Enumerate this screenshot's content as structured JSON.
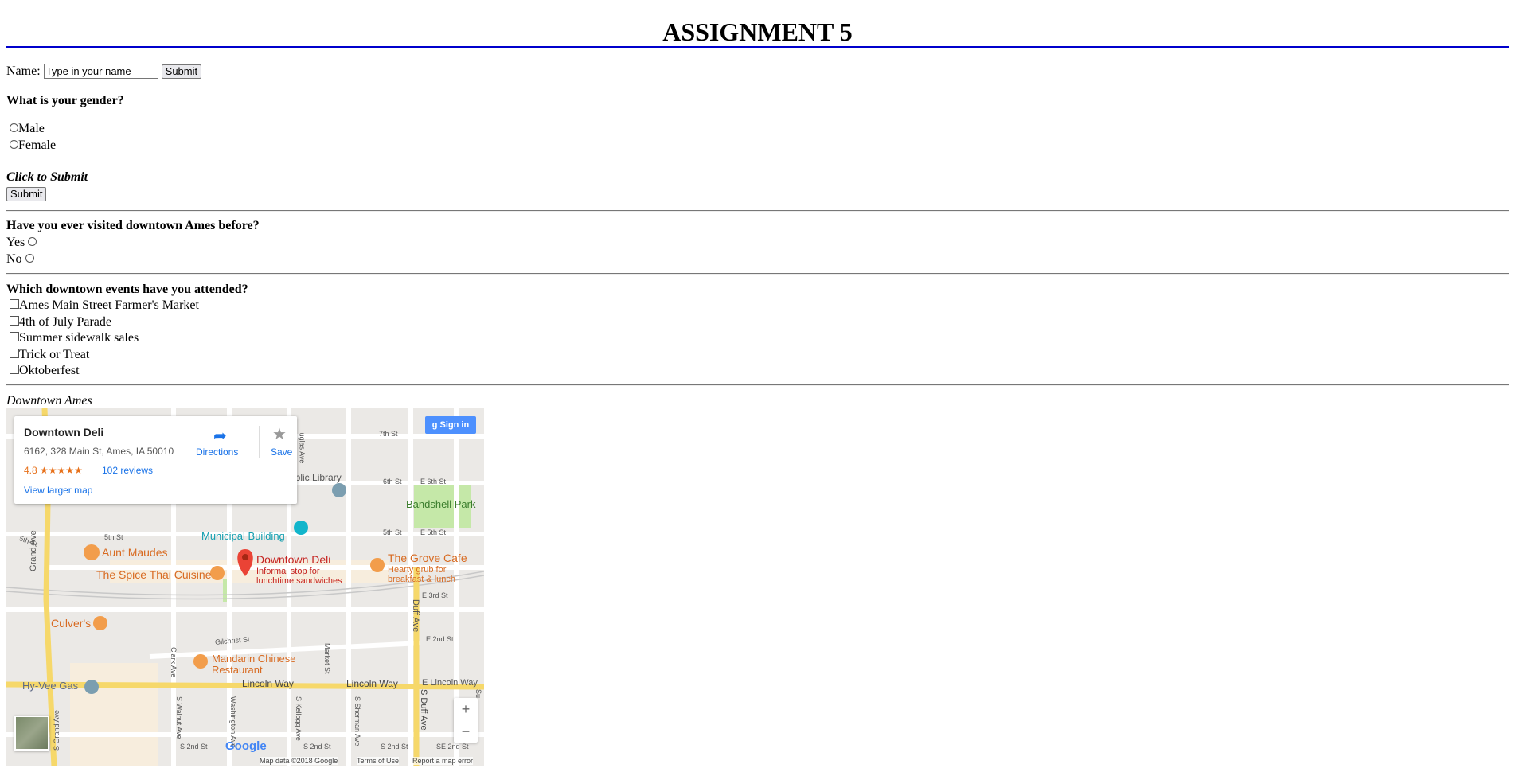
{
  "page_title": "ASSIGNMENT 5",
  "name_field": {
    "label": "Name:",
    "value": "Type in your name",
    "submit": "Submit"
  },
  "gender": {
    "question": "What is your gender?",
    "options": [
      "Male",
      "Female"
    ]
  },
  "click_to_submit": {
    "label": "Click to Submit",
    "button": "Submit"
  },
  "visited": {
    "question": "Have you ever visited downtown Ames before?",
    "options": [
      "Yes",
      "No"
    ]
  },
  "events": {
    "question": "Which downtown events have you attended?",
    "options": [
      "Ames Main Street Farmer's Market",
      "4th of July Parade",
      "Summer sidewalk sales",
      "Trick or Treat",
      "Oktoberfest"
    ]
  },
  "map_caption": "Downtown Ames",
  "map": {
    "place_name": "Downtown Deli",
    "address": "6162, 328 Main St, Ames, IA 50010",
    "rating": "4.8",
    "stars": "★★★★★",
    "reviews": "102 reviews",
    "view_larger": "View larger map",
    "directions": "Directions",
    "save": "Save",
    "sign_in": "Sign in",
    "google": "Google",
    "footer": {
      "data": "Map data ©2018 Google",
      "terms": "Terms of Use",
      "report": "Report a map error"
    },
    "labels": {
      "public_library": "ublic Library",
      "bandshell_park": "Bandshell Park",
      "municipal_building": "Municipal Building",
      "aunt_maudes": "Aunt Maudes",
      "spice_thai": "The Spice Thai Cuisine",
      "deli_pin": "Downtown Deli",
      "deli_sub1": "Informal stop for",
      "deli_sub2": "lunchtime sandwiches",
      "grove_cafe": "The Grove Cafe",
      "grove_sub1": "Hearty grub for",
      "grove_sub2": "breakfast & lunch",
      "culvers": "Culver's",
      "mandarin1": "Mandarin Chinese",
      "mandarin2": "Restaurant",
      "hyvee": "Hy-Vee Gas",
      "lincoln_way_1": "Lincoln Way",
      "lincoln_way_2": "Lincoln Way",
      "e_lincoln_way": "E Lincoln Way",
      "grand_ave": "Grand Ave",
      "s_grand_ave": "S Grand Ave",
      "duff_ave": "Duff Ave",
      "s_duff_ave": "S Duff Ave",
      "st_7th": "7th St",
      "st_6th": "6th St",
      "e_6th": "E 6th St",
      "st_5th_a": "5th St",
      "st_5th_b": "5th St",
      "st_5th_c": "5th St",
      "e_5th": "E 5th St",
      "e_3rd": "E 3rd St",
      "e_2nd": "E 2nd St",
      "gilchrist": "Gilchrist St",
      "clark_ave": "Clark Ave",
      "market_st": "Market St",
      "s_2nd_a": "S 2nd St",
      "s_2nd_b": "S 2nd St",
      "s_2nd_c": "S 2nd St",
      "se_2nd": "SE 2nd St",
      "douglas": "uglas Ave",
      "s_walnut": "S Walnut Ave",
      "washington": "Washington Ave",
      "s_kellogg": "S Kellogg Ave",
      "s_sherman": "S Sherman Ave",
      "su": "Su",
      "e": "e"
    }
  }
}
